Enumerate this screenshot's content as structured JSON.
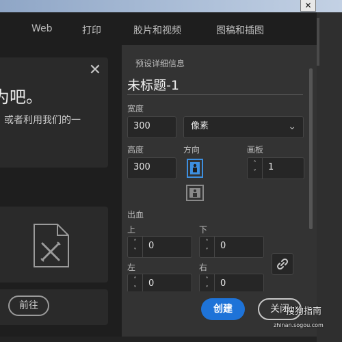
{
  "window": {
    "close_glyph": "✕"
  },
  "tabs": [
    {
      "label": "Web"
    },
    {
      "label": "打印"
    },
    {
      "label": "胶片和视频"
    },
    {
      "label": "图稿和插图"
    }
  ],
  "welcome": {
    "heading": "为吧。",
    "text": "，或者利用我们的一",
    "close_glyph": "✕"
  },
  "goto": {
    "label": "前往"
  },
  "details": {
    "header": "预设详细信息",
    "title": "未标题-1",
    "width_label": "宽度",
    "width_value": "300",
    "unit_value": "像素",
    "height_label": "高度",
    "height_value": "300",
    "orientation_label": "方向",
    "artboard_label": "画板",
    "artboard_value": "1",
    "bleed_label": "出血",
    "bleed_top_label": "上",
    "bleed_bottom_label": "下",
    "bleed_left_label": "左",
    "bleed_right_label": "右",
    "bleed_top": "0",
    "bleed_bottom": "0",
    "bleed_left": "0",
    "bleed_right": "0"
  },
  "footer": {
    "create_label": "创建",
    "close_label": "关闭"
  },
  "watermark": {
    "text": "搜狗指南",
    "sub": "zhinan.sogou.com"
  },
  "colors": {
    "accent": "#1e73d8",
    "panel": "#333333",
    "background": "#1e1e1e",
    "portrait_active": "#3d8fe0"
  }
}
